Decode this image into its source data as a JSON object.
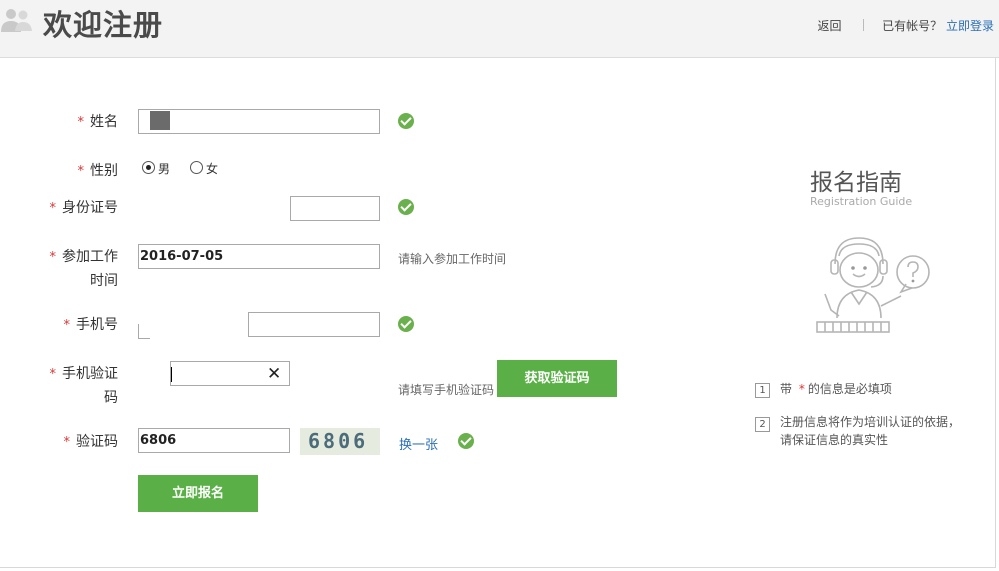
{
  "header": {
    "title": "欢迎注册",
    "back_label": "返回",
    "have_account_text": "已有帐号？",
    "login_link": "立即登录"
  },
  "form": {
    "required_mark": "*",
    "name": {
      "label": "姓名",
      "value": ""
    },
    "gender": {
      "label": "性别",
      "options": [
        "男",
        "女"
      ],
      "selected": "男"
    },
    "id_card": {
      "label": "身份证号",
      "value": ""
    },
    "work_start": {
      "label_line1": "参加工作",
      "label_line2": "时间",
      "value": "2016-07-05",
      "hint": "请输入参加工作时间"
    },
    "mobile": {
      "label": "手机号",
      "value": ""
    },
    "sms_code": {
      "label_line1": "手机验证",
      "label_line2": "码",
      "value": "",
      "hint": "请填写手机验证码",
      "get_code_button": "获取验证码",
      "clear_icon": "✕"
    },
    "captcha": {
      "label": "验证码",
      "value": "6806",
      "image_text": "6806",
      "refresh_link": "换一张"
    },
    "submit_button": "立即报名"
  },
  "guide": {
    "title": "报名指南",
    "subtitle": "Registration Guide",
    "steps": [
      {
        "num": "1",
        "text_before": "带",
        "star": "*",
        "text_after": "的信息是必填项"
      },
      {
        "num": "2",
        "line1": "注册信息将作为培训认证的依据，",
        "line2": "请保证信息的真实性"
      }
    ]
  }
}
